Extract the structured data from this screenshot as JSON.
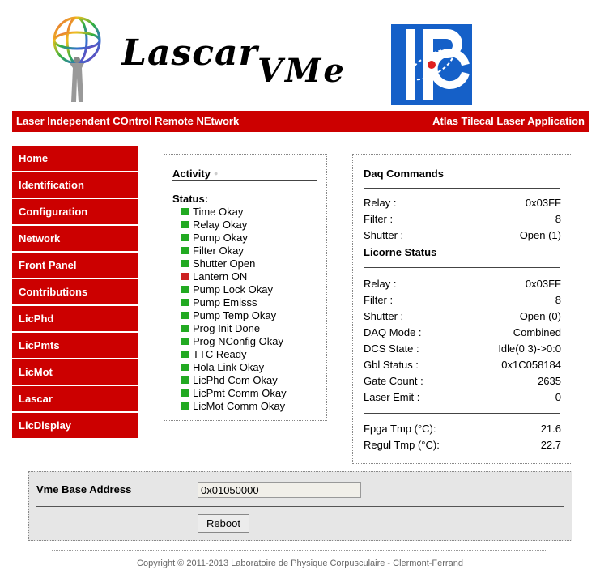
{
  "header": {
    "logo_text": "Lascar",
    "logo_suffix": "VMe",
    "banner_left": "Laser Independent COntrol Remote NEtwork",
    "banner_right": "Atlas Tilecal Laser Application"
  },
  "colors": {
    "accent": "#cc0000",
    "ok": "#22aa22",
    "alert": "#cc2222"
  },
  "sidebar": {
    "items": [
      {
        "label": "Home"
      },
      {
        "label": "Identification"
      },
      {
        "label": "Configuration"
      },
      {
        "label": "Network"
      },
      {
        "label": "Front Panel"
      },
      {
        "label": "Contributions"
      },
      {
        "label": "LicPhd"
      },
      {
        "label": "LicPmts"
      },
      {
        "label": "LicMot"
      },
      {
        "label": "Lascar"
      },
      {
        "label": "LicDisplay"
      }
    ]
  },
  "activity": {
    "title": "Activity",
    "status_label": "Status:",
    "statuses": [
      {
        "text": "Time Okay",
        "state": "ok"
      },
      {
        "text": "Relay Okay",
        "state": "ok"
      },
      {
        "text": "Pump Okay",
        "state": "ok"
      },
      {
        "text": "Filter Okay",
        "state": "ok"
      },
      {
        "text": "Shutter Open",
        "state": "ok"
      },
      {
        "text": "Lantern ON",
        "state": "alert"
      },
      {
        "text": "Pump Lock Okay",
        "state": "ok"
      },
      {
        "text": "Pump Emisss",
        "state": "ok"
      },
      {
        "text": "Pump Temp Okay",
        "state": "ok"
      },
      {
        "text": "Prog Init Done",
        "state": "ok"
      },
      {
        "text": "Prog NConfig Okay",
        "state": "ok"
      },
      {
        "text": "TTC Ready",
        "state": "ok"
      },
      {
        "text": "Hola Link Okay",
        "state": "ok"
      },
      {
        "text": "LicPhd Com Okay",
        "state": "ok"
      },
      {
        "text": "LicPmt Comm Okay",
        "state": "ok"
      },
      {
        "text": "LicMot Comm Okay",
        "state": "ok"
      }
    ]
  },
  "daq": {
    "title": "Daq Commands",
    "commands": [
      {
        "label": "Relay :",
        "value": "0x03FF"
      },
      {
        "label": "Filter :",
        "value": "8"
      },
      {
        "label": "Shutter :",
        "value": "Open (1)"
      }
    ],
    "licorne_title": "Licorne Status",
    "licorne": [
      {
        "label": "Relay :",
        "value": "0x03FF"
      },
      {
        "label": "Filter :",
        "value": "8"
      },
      {
        "label": "Shutter :",
        "value": "Open (0)"
      },
      {
        "label": "DAQ Mode :",
        "value": "Combined"
      },
      {
        "label": "DCS State :",
        "value": "Idle(0 3)->0:0"
      },
      {
        "label": "Gbl Status :",
        "value": "0x1C058184"
      },
      {
        "label": "Gate Count :",
        "value": "2635"
      },
      {
        "label": "Laser Emit :",
        "value": "0"
      }
    ],
    "temps": [
      {
        "label": "Fpga Tmp (°C):",
        "value": "21.6"
      },
      {
        "label": "Regul Tmp (°C):",
        "value": "22.7"
      }
    ]
  },
  "form": {
    "base_label": "Vme Base Address",
    "base_value": "0x01050000",
    "reboot_label": "Reboot"
  },
  "footer": "Copyright © 2011-2013 Laboratoire de Physique Corpusculaire - Clermont-Ferrand"
}
